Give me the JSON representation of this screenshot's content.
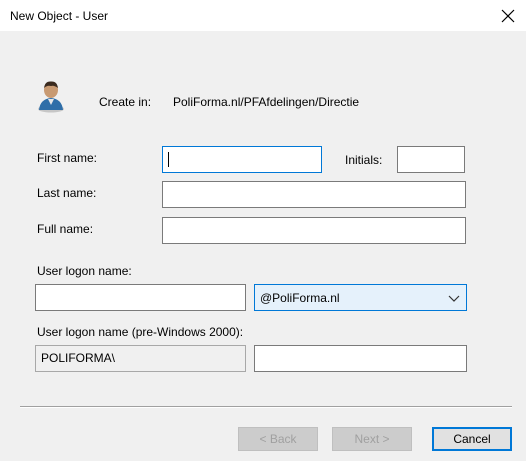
{
  "dialog": {
    "title": "New Object - User",
    "close_icon": "close-icon"
  },
  "create_in": {
    "label": "Create in:",
    "path": "PoliForma.nl/PFAfdelingen/Directie",
    "icon": "user-icon"
  },
  "form": {
    "first_name_label": "First name:",
    "first_name_value": "",
    "initials_label": "Initials:",
    "initials_value": "",
    "last_name_label": "Last name:",
    "last_name_value": "",
    "full_name_label": "Full name:",
    "full_name_value": "",
    "logon_name_label": "User logon name:",
    "logon_name_value": "",
    "upn_suffix": "@PoliForma.nl",
    "pre2000_label": "User logon name (pre-Windows 2000):",
    "pre2000_domain": "POLIFORMA\\",
    "pre2000_value": ""
  },
  "buttons": {
    "back": "< Back",
    "next": "Next >",
    "cancel": "Cancel"
  },
  "colors": {
    "accent": "#0078d7",
    "dialog_bg": "#f0f0f0"
  }
}
